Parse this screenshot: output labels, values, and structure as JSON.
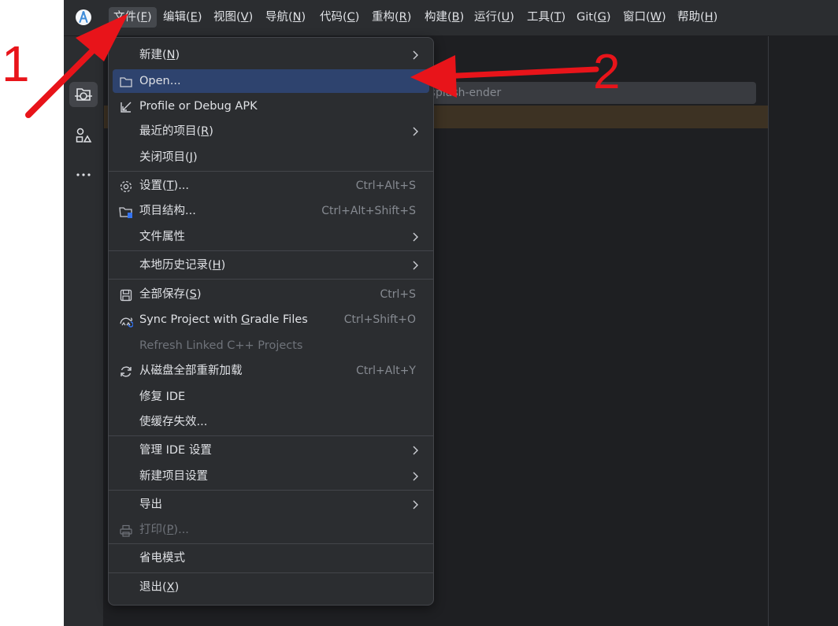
{
  "menubar": {
    "items": [
      {
        "pre": "文件(",
        "mn": "F",
        "post": ")"
      },
      {
        "pre": "编辑(",
        "mn": "E",
        "post": ")"
      },
      {
        "pre": "视图(",
        "mn": "V",
        "post": ")"
      },
      {
        "pre": "导航(",
        "mn": "N",
        "post": ")"
      },
      {
        "pre": "代码(",
        "mn": "C",
        "post": ")"
      },
      {
        "pre": "重构(",
        "mn": "R",
        "post": ")"
      },
      {
        "pre": "构建(",
        "mn": "B",
        "post": ")"
      },
      {
        "pre": "运行(",
        "mn": "U",
        "post": ")"
      },
      {
        "pre": "工具(",
        "mn": "T",
        "post": ")"
      },
      {
        "pre": "Git(",
        "mn": "G",
        "post": ")"
      },
      {
        "pre": "窗口(",
        "mn": "W",
        "post": ")"
      },
      {
        "pre": "帮助(",
        "mn": "H",
        "post": ")"
      }
    ]
  },
  "editor": {
    "path_text": "esktop\\splash-ender"
  },
  "file_menu": {
    "items": [
      {
        "pre": "新建(",
        "mn": "N",
        "post": ")",
        "icon": "",
        "shortcut": "",
        "submenu": true
      },
      {
        "pre": "Open...",
        "mn": "",
        "post": "",
        "icon": "folder-icon",
        "shortcut": "",
        "submenu": false,
        "highlighted": true
      },
      {
        "pre": "Profile or Debug APK",
        "mn": "",
        "post": "",
        "icon": "arrow-down-left-icon",
        "shortcut": "",
        "submenu": false
      },
      {
        "pre": "最近的项目(",
        "mn": "R",
        "post": ")",
        "icon": "",
        "shortcut": "",
        "submenu": true
      },
      {
        "pre": "关闭项目(",
        "mn": "J",
        "post": ")",
        "icon": "",
        "shortcut": "",
        "submenu": false
      },
      {
        "pre": "设置(",
        "mn": "T",
        "post": ")...",
        "icon": "gear-icon",
        "shortcut": "Ctrl+Alt+S",
        "submenu": false
      },
      {
        "pre": "项目结构...",
        "mn": "",
        "post": "",
        "icon": "project-structure-icon",
        "shortcut": "Ctrl+Alt+Shift+S",
        "submenu": false
      },
      {
        "pre": "文件属性",
        "mn": "",
        "post": "",
        "icon": "",
        "shortcut": "",
        "submenu": true
      },
      {
        "pre": "本地历史记录(",
        "mn": "H",
        "post": ")",
        "icon": "",
        "shortcut": "",
        "submenu": true
      },
      {
        "pre": "全部保存(",
        "mn": "S",
        "post": ")",
        "icon": "save-icon",
        "shortcut": "Ctrl+S",
        "submenu": false
      },
      {
        "pre": "Sync Project with ",
        "mn": "G",
        "post": "radle Files",
        "icon": "gradle-sync-icon",
        "shortcut": "Ctrl+Shift+O",
        "submenu": false
      },
      {
        "pre": "Refresh Linked C++ Projects",
        "mn": "",
        "post": "",
        "icon": "",
        "shortcut": "",
        "submenu": false,
        "disabled": true
      },
      {
        "pre": "从磁盘全部重新加载",
        "mn": "",
        "post": "",
        "icon": "reload-icon",
        "shortcut": "Ctrl+Alt+Y",
        "submenu": false
      },
      {
        "pre": "修复 IDE",
        "mn": "",
        "post": "",
        "icon": "",
        "shortcut": "",
        "submenu": false
      },
      {
        "pre": "使缓存失效...",
        "mn": "",
        "post": "",
        "icon": "",
        "shortcut": "",
        "submenu": false
      },
      {
        "pre": "管理 IDE 设置",
        "mn": "",
        "post": "",
        "icon": "",
        "shortcut": "",
        "submenu": true
      },
      {
        "pre": "新建项目设置",
        "mn": "",
        "post": "",
        "icon": "",
        "shortcut": "",
        "submenu": true
      },
      {
        "pre": "导出",
        "mn": "",
        "post": "",
        "icon": "",
        "shortcut": "",
        "submenu": true
      },
      {
        "pre": "打印(",
        "mn": "P",
        "post": ")...",
        "icon": "printer-icon",
        "shortcut": "",
        "submenu": false,
        "disabled": true
      },
      {
        "pre": "省电模式",
        "mn": "",
        "post": "",
        "icon": "",
        "shortcut": "",
        "submenu": false
      },
      {
        "pre": "退出(",
        "mn": "X",
        "post": ")",
        "icon": "",
        "shortcut": "",
        "submenu": false
      }
    ]
  },
  "annotations": {
    "label_1": "1",
    "label_2": "2",
    "color": "#e8141a"
  },
  "colors": {
    "menu_bg": "#2b2d30",
    "highlight": "#2e436e",
    "editor_bg": "#1e1f22",
    "warning_bar": "#3d3223"
  }
}
